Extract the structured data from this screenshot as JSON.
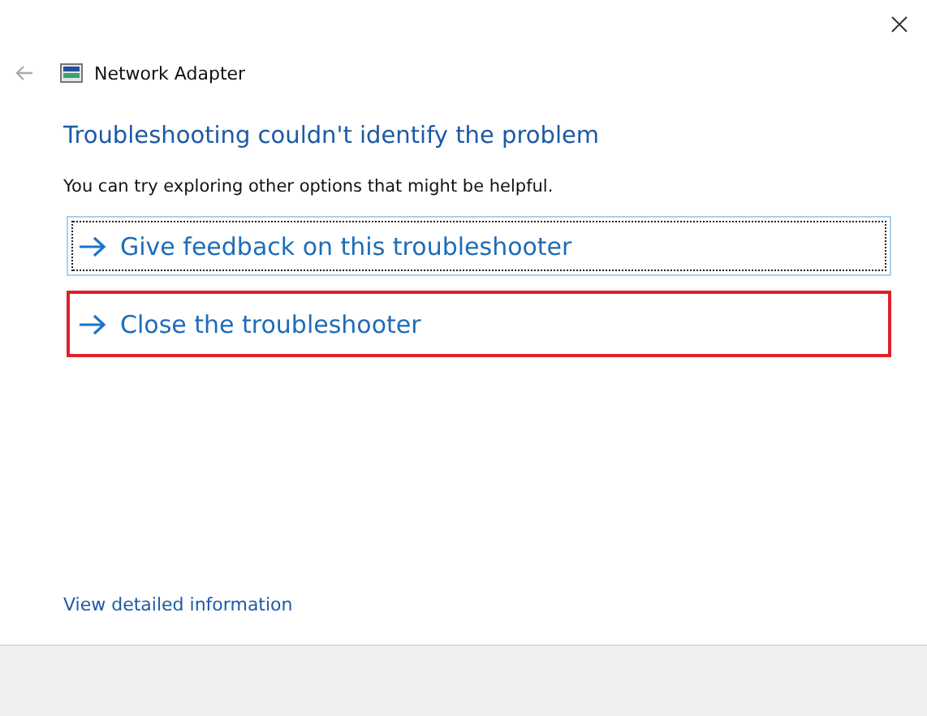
{
  "window": {
    "title": "Network Adapter"
  },
  "heading": "Troubleshooting couldn't identify the problem",
  "description": "You can try exploring other options that might be helpful.",
  "options": [
    {
      "label": "Give feedback on this troubleshooter",
      "focused": true,
      "highlighted": false
    },
    {
      "label": "Close the troubleshooter",
      "focused": false,
      "highlighted": true
    }
  ],
  "details_link": "View detailed information"
}
